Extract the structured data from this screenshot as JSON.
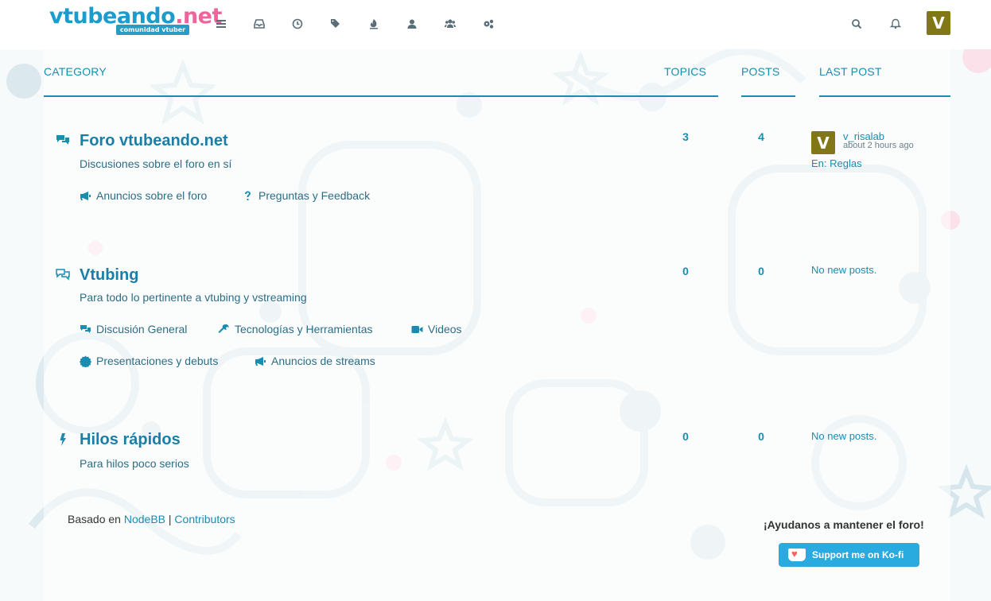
{
  "navbar": {
    "logo_main_a": "vtubeando",
    "logo_main_b": ".net",
    "logo_sub": "comunidad vtuber",
    "avatar_letter": "V",
    "icons": [
      "bars-icon",
      "inbox-icon",
      "clock-icon",
      "tags-icon",
      "fire-icon",
      "user-icon",
      "users-icon",
      "cogs-icon"
    ],
    "right_icons": [
      "search-icon",
      "bell-icon"
    ]
  },
  "table": {
    "col_category": "CATEGORY",
    "col_topics": "TOPICS",
    "col_posts": "POSTS",
    "col_last_post": "LAST POST"
  },
  "categories": [
    {
      "title": "Foro vtubeando.net",
      "description": "Discusiones sobre el foro en sí",
      "topics": "3",
      "posts": "4",
      "subcategories": [
        {
          "label": "Anuncios sobre el foro",
          "icon": "bullhorn-icon"
        },
        {
          "label": "Preguntas y Feedback",
          "icon": "question-icon"
        }
      ],
      "last_post": {
        "avatar": "V",
        "user": "v_risalab",
        "time": "about 2 hours ago",
        "in_label": "En: Reglas"
      }
    },
    {
      "title": "Vtubing",
      "description": "Para todo lo pertinente a vtubing y vstreaming",
      "topics": "0",
      "posts": "0",
      "subcategories": [
        {
          "label": "Discusión General",
          "icon": "comments-icon"
        },
        {
          "label": "Tecnologías y Herramientas",
          "icon": "wrench-icon"
        },
        {
          "label": "Videos",
          "icon": "video-icon"
        },
        {
          "label": "Presentaciones y debuts",
          "icon": "certificate-icon"
        },
        {
          "label": "Anuncios de streams",
          "icon": "bullhorn-icon"
        }
      ],
      "last_post": {
        "none": "No new posts."
      }
    },
    {
      "title": "Hilos rápidos",
      "description": "Para hilos poco serios",
      "topics": "0",
      "posts": "0",
      "subcategories": [],
      "last_post": {
        "none": "No new posts."
      }
    }
  ],
  "footer": {
    "powered_prefix": "Basado en",
    "nodebb": "NodeBB",
    "separator": "|",
    "contributors": "Contributors",
    "support_title": "¡Ayudanos a mantener el foro!",
    "kofi_label": "Support me on Ko-fi"
  },
  "colors": {
    "accent": "#1a8cb0",
    "avatar_bg": "#827717",
    "kofi_bg": "#29abe0"
  }
}
